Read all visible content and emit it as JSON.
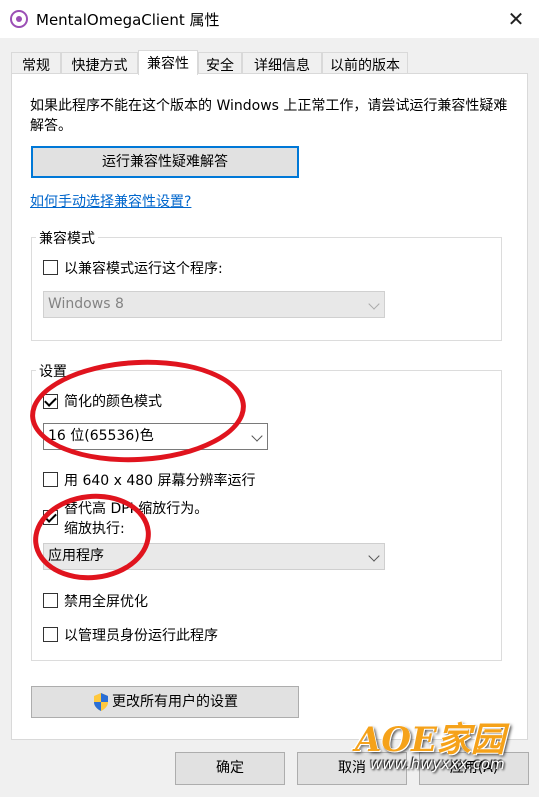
{
  "window": {
    "title": "MentalOmegaClient 属性",
    "close_glyph": "✕",
    "accent": "#0078d7"
  },
  "tabs": [
    {
      "label": "常规"
    },
    {
      "label": "快捷方式"
    },
    {
      "label": "兼容性"
    },
    {
      "label": "安全"
    },
    {
      "label": "详细信息"
    },
    {
      "label": "以前的版本"
    }
  ],
  "compat": {
    "description": "如果此程序不能在这个版本的 Windows 上正常工作，请尝试运行兼容性疑难解答。",
    "troubleshoot_button": "运行兼容性疑难解答",
    "manual_link": "如何手动选择兼容性设置?",
    "mode_group": {
      "label": "兼容模式",
      "checkbox_label": "以兼容模式运行这个程序:",
      "checked": false,
      "select_value": "Windows 8"
    },
    "settings_group": {
      "label": "设置",
      "reduced_color": {
        "label": "简化的颜色模式",
        "checked": true
      },
      "color_select_value": "16 位(65536)色",
      "res_640": {
        "label": "用 640 x 480 屏幕分辨率运行",
        "checked": false
      },
      "dpi_override": {
        "label_line1": "替代高 DPI 缩放行为。",
        "label_line2": "缩放执行:",
        "checked": true
      },
      "dpi_select_value": "应用程序",
      "disable_fullscreen": {
        "label": "禁用全屏优化",
        "checked": false
      },
      "run_as_admin": {
        "label": "以管理员身份运行此程序",
        "checked": false
      }
    },
    "change_all_button": "更改所有用户的设置"
  },
  "footer": {
    "ok": "确定",
    "cancel": "取消",
    "apply": "应用(A)"
  },
  "watermark": {
    "text": "AOE家园",
    "url": "www.hwyxxx.com"
  },
  "icons": {
    "app": "mental-omega-icon",
    "shield": "uac-shield-icon",
    "close": "close-icon",
    "chevron": "chevron-down-icon"
  }
}
